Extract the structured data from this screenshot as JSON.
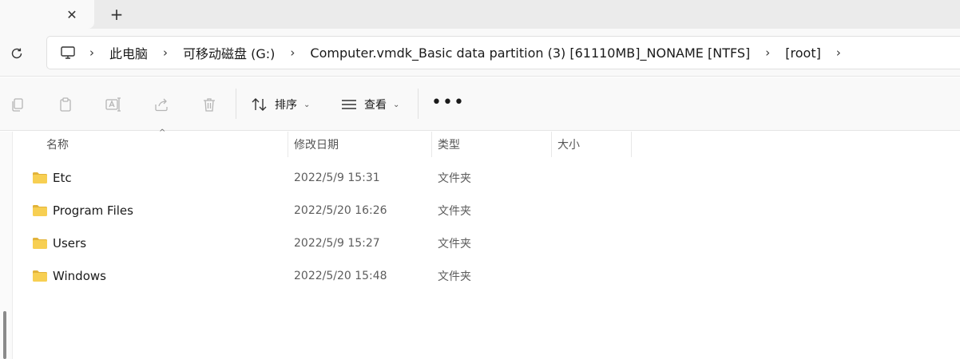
{
  "tabs": {
    "close_glyph": "✕",
    "new_glyph": "+"
  },
  "breadcrumb": {
    "separator": "›",
    "items": [
      {
        "label": "此电脑"
      },
      {
        "label": "可移动磁盘 (G:)"
      },
      {
        "label": "Computer.vmdk_Basic data partition (3) [61110MB]_NONAME [NTFS]"
      },
      {
        "label": "[root]"
      }
    ]
  },
  "toolbar": {
    "sort_label": "排序",
    "view_label": "查看",
    "more_label": "•••",
    "icons": [
      "copy-icon",
      "paste-icon",
      "rename-icon",
      "share-icon",
      "delete-icon"
    ]
  },
  "columns": {
    "name": "名称",
    "modified": "修改日期",
    "type": "类型",
    "size": "大小",
    "sort_indicator": "^"
  },
  "files": [
    {
      "name": "Etc",
      "modified": "2022/5/9 15:31",
      "type": "文件夹"
    },
    {
      "name": "Program Files",
      "modified": "2022/5/20 16:26",
      "type": "文件夹"
    },
    {
      "name": "Users",
      "modified": "2022/5/9 15:27",
      "type": "文件夹"
    },
    {
      "name": "Windows",
      "modified": "2022/5/20 15:48",
      "type": "文件夹"
    }
  ],
  "colors": {
    "folder": "#f2c94c",
    "folder_dark": "#e2b33a",
    "accent": "#1a1a1a"
  }
}
